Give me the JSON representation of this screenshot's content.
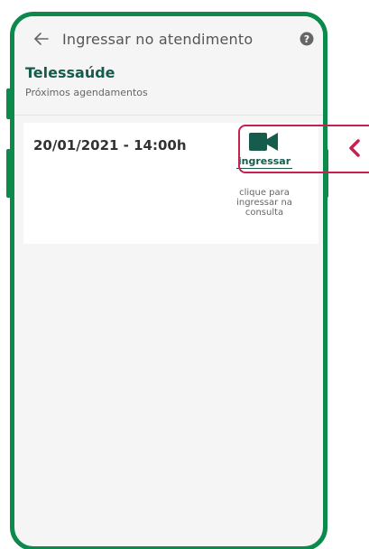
{
  "header": {
    "title": "Ingressar no atendimento",
    "back_icon": "arrow-left-icon",
    "help_icon": "question-circle-icon"
  },
  "section": {
    "title": "Telessaúde",
    "subtitle": "Próximos agendamentos"
  },
  "appointment": {
    "datetime": "20/01/2021 - 14:00h",
    "join_label": "ingressar",
    "join_icon": "video-camera-icon",
    "hint": "clique para ingressar na consulta"
  },
  "colors": {
    "phone_frame": "#0b8a4c",
    "primary_text": "#155c4c",
    "highlight": "#c8214f",
    "screen_bg": "#f5f5f5"
  }
}
